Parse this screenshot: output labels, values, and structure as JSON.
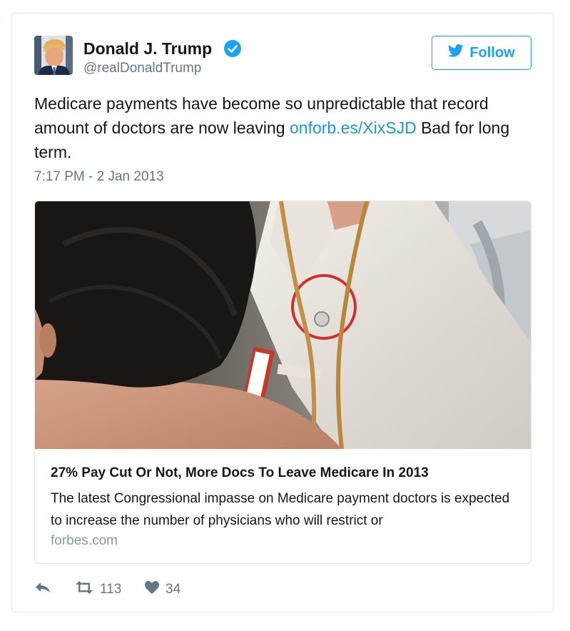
{
  "author": {
    "name": "Donald J. Trump",
    "handle": "@realDonaldTrump",
    "verified": true
  },
  "follow_button": {
    "label": "Follow"
  },
  "tweet": {
    "text_before_link": "Medicare payments have become so unpredictable that record amount of doctors are now leaving ",
    "link_text": "onforb.es/XixSJD",
    "text_after_link": " Bad for long term.",
    "timestamp": "7:17 PM - 2 Jan 2013"
  },
  "link_preview": {
    "title": "27% Pay Cut Or Not, More Docs To Leave Medicare In 2013",
    "description": "The latest Congressional impasse on Medicare payment doctors is expected to increase the number of physicians who will restrict or",
    "domain": "forbes.com"
  },
  "actions": {
    "reply_icon": "reply-icon",
    "retweet_icon": "retweet-icon",
    "like_icon": "heart-icon",
    "retweet_count": "113",
    "like_count": "34"
  },
  "colors": {
    "accent": "#1da1f2",
    "link": "#1b95e0",
    "muted": "#657786"
  }
}
